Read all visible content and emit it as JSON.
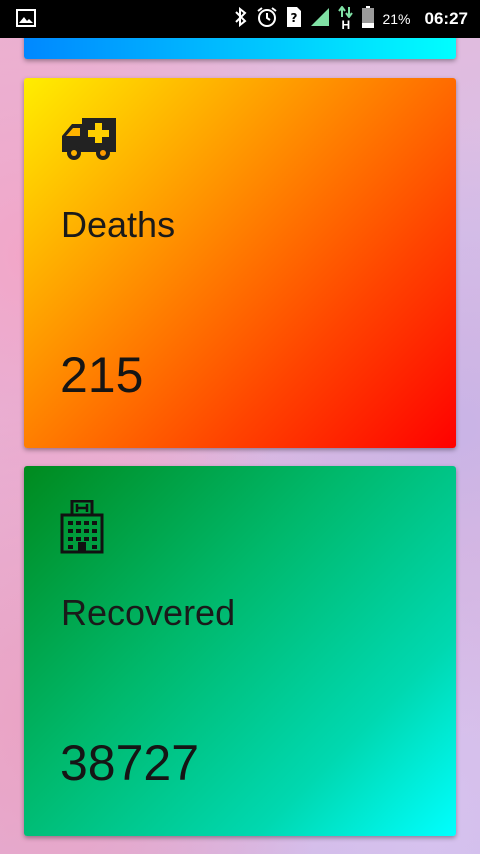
{
  "status_bar": {
    "battery_percent": "21%",
    "time": "06:27",
    "network_type": "H",
    "icons": [
      "gallery-icon",
      "bluetooth-icon",
      "alarm-icon",
      "sim-unknown-icon",
      "signal-icon",
      "data-arrows-icon",
      "battery-icon"
    ]
  },
  "cards": {
    "top_partial": {
      "accent_start": "#0088ff",
      "accent_end": "#00ffff"
    },
    "deaths": {
      "icon": "ambulance-icon",
      "label": "Deaths",
      "value": "215",
      "gradient": [
        "#ffee00",
        "#ff9900",
        "#ff0000"
      ]
    },
    "recovered": {
      "icon": "hospital-icon",
      "label": "Recovered",
      "value": "38727",
      "gradient": [
        "#008a1e",
        "#00d8b0",
        "#00ffff"
      ]
    }
  }
}
